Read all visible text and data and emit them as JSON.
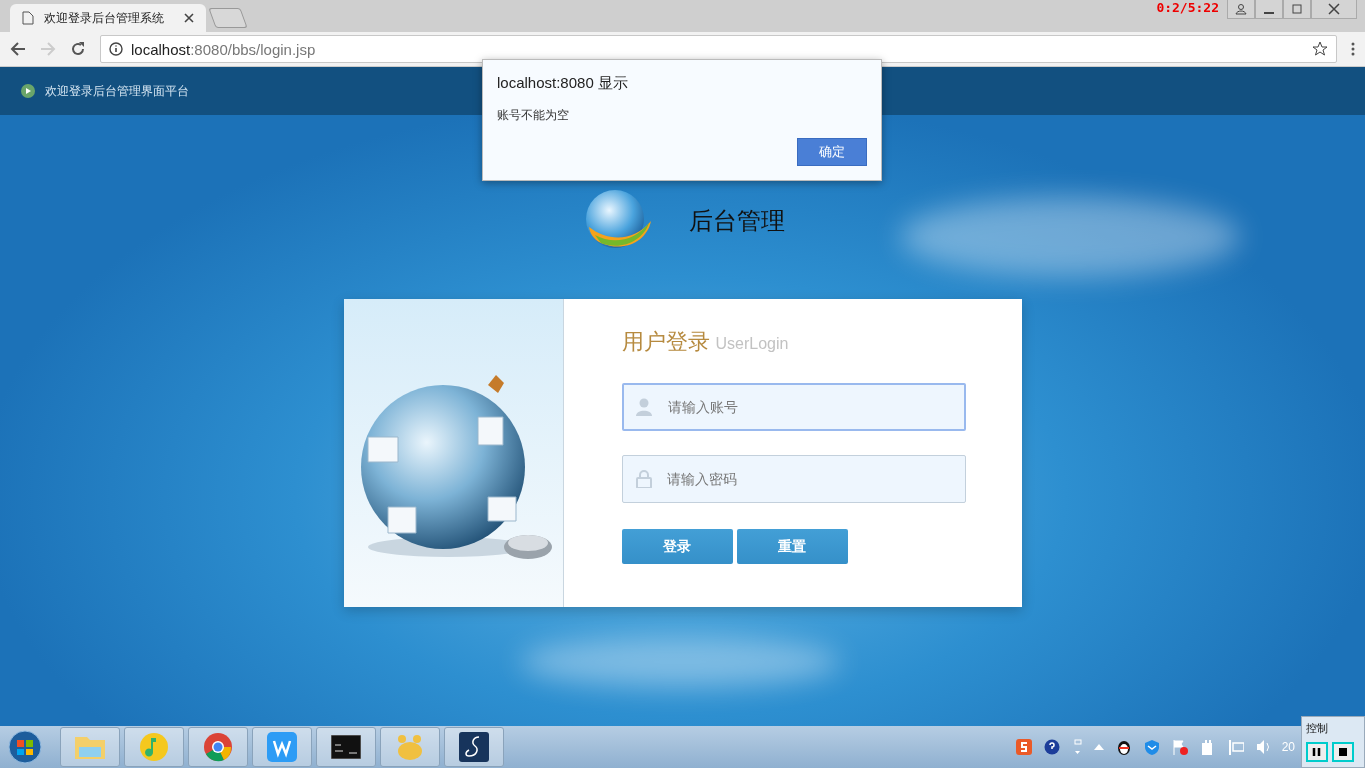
{
  "browser": {
    "tab": {
      "title": "欢迎登录后台管理系统"
    },
    "address": {
      "host": "localhost",
      "rest": ":8080/bbs/login.jsp"
    },
    "recorder_timer": "0:2/5:22"
  },
  "page": {
    "header_text": "欢迎登录后台管理界面平台",
    "brand_title": "后台管理",
    "login": {
      "title": "用户登录",
      "subtitle": "UserLogin",
      "fields": [
        {
          "kind": "user",
          "placeholder": "请输入账号",
          "focused": true
        },
        {
          "kind": "password",
          "placeholder": "请输入密码",
          "focused": false
        }
      ],
      "buttons": [
        "登录",
        "重置"
      ]
    }
  },
  "dialog": {
    "title": "localhost:8080 显示",
    "message": "账号不能为空",
    "ok_button": "确定"
  },
  "taskbar": {
    "apps": [
      {
        "kind": "folder"
      },
      {
        "kind": "music"
      },
      {
        "kind": "chrome"
      },
      {
        "kind": "writer"
      },
      {
        "kind": "console"
      },
      {
        "kind": "paw"
      },
      {
        "kind": "script"
      }
    ],
    "clock": "20",
    "control_panel": {
      "title": "控制"
    }
  }
}
